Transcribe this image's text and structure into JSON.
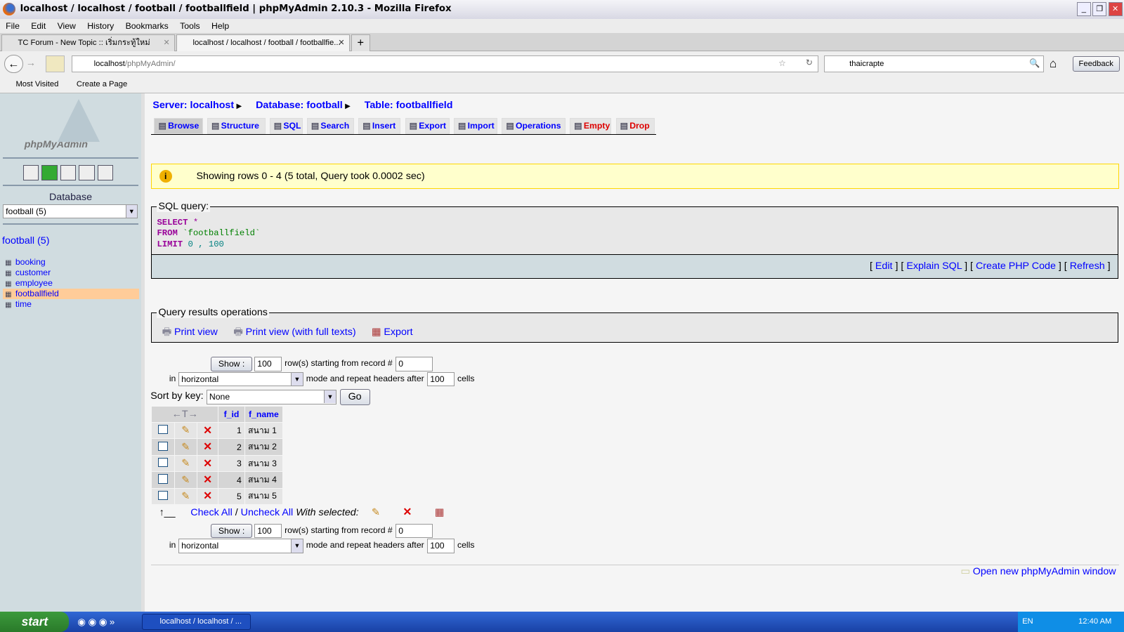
{
  "window": {
    "title": "localhost / localhost / football / footballfield | phpMyAdmin 2.10.3 - Mozilla Firefox"
  },
  "menu": [
    "File",
    "Edit",
    "View",
    "History",
    "Bookmarks",
    "Tools",
    "Help"
  ],
  "tabs": [
    {
      "label": "TC Forum - New Topic :: เริ่มกระทู้ใหม่",
      "active": false
    },
    {
      "label": "localhost / localhost / football / footballfie...",
      "active": true
    }
  ],
  "nav": {
    "url_host": "localhost",
    "url_path": "/phpMyAdmin/",
    "search_value": "thaicrapte",
    "feedback": "Feedback"
  },
  "bookmarks": [
    "Most Visited",
    "Create a Page"
  ],
  "sidebar": {
    "logo": "phpMyAdmin",
    "db_label": "Database",
    "db_select": "football (5)",
    "db_link": "football (5)",
    "tables": [
      {
        "name": "booking",
        "selected": false
      },
      {
        "name": "customer",
        "selected": false
      },
      {
        "name": "employee",
        "selected": false
      },
      {
        "name": "footballfield",
        "selected": true
      },
      {
        "name": "time",
        "selected": false
      }
    ]
  },
  "breadcrumb": {
    "server": "Server: localhost",
    "database": "Database: football",
    "table": "Table: footballfield"
  },
  "page_tabs": [
    "Browse",
    "Structure",
    "SQL",
    "Search",
    "Insert",
    "Export",
    "Import",
    "Operations",
    "Empty",
    "Drop"
  ],
  "notice": "Showing rows 0 - 4 (5 total, Query took 0.0002 sec)",
  "sql": {
    "legend": "SQL query:",
    "line1_kw": "SELECT",
    "line1_rest": " *",
    "line2_kw": "FROM",
    "line2_rest": " `footballfield`",
    "line3_kw": "LIMIT",
    "line3_rest": " 0 , 100",
    "links": [
      "Edit",
      "Explain SQL",
      "Create PHP Code",
      "Refresh"
    ]
  },
  "ops": {
    "legend": "Query results operations",
    "links": [
      "Print view",
      "Print view (with full texts)",
      "Export"
    ]
  },
  "nav_form": {
    "show": "Show :",
    "rows": "100",
    "rows_text": "row(s) starting from record #",
    "start": "0",
    "in": "in",
    "mode": "horizontal",
    "mode_text": "mode and repeat headers after",
    "repeat": "100",
    "cells": "cells"
  },
  "sort": {
    "label": "Sort by key:",
    "value": "None",
    "go": "Go"
  },
  "table": {
    "columns": [
      "f_id",
      "f_name"
    ],
    "rows": [
      [
        "1",
        "สนาม 1"
      ],
      [
        "2",
        "สนาม 2"
      ],
      [
        "3",
        "สนาม 3"
      ],
      [
        "4",
        "สนาม 4"
      ],
      [
        "5",
        "สนาม 5"
      ]
    ]
  },
  "bulk": {
    "check_all": "Check All",
    "sep": "/",
    "uncheck_all": "Uncheck All",
    "with_selected": "With selected:"
  },
  "footer_link": "Open new phpMyAdmin window",
  "taskbar": {
    "start": "start",
    "task": "localhost / localhost / ...",
    "lang": "EN",
    "clock": "12:40 AM"
  }
}
